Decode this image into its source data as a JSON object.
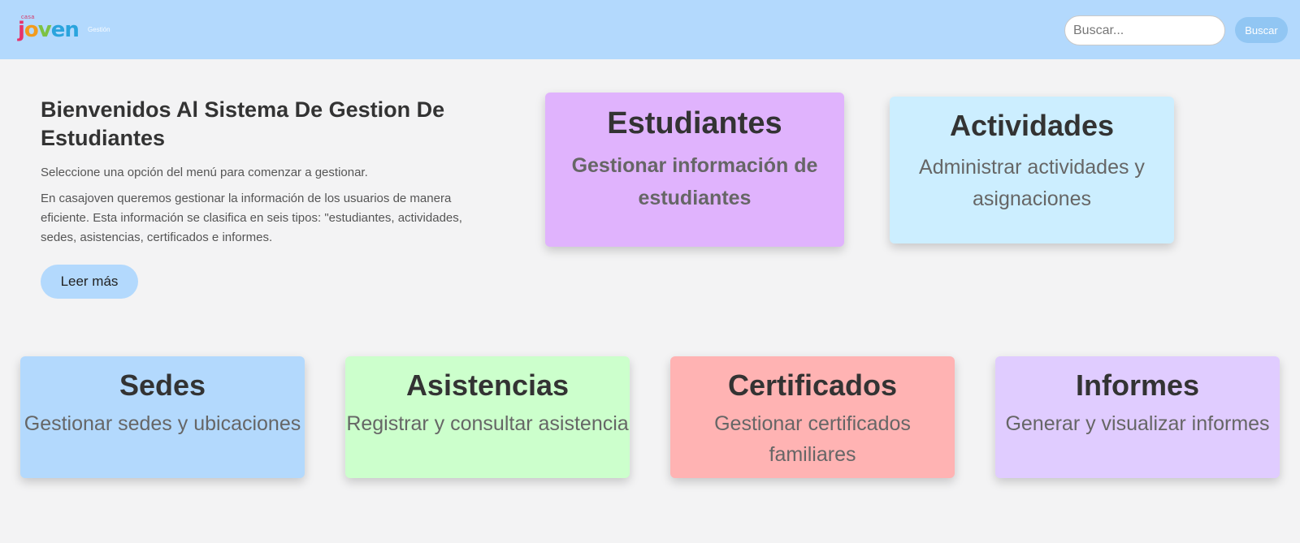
{
  "header": {
    "logo": {
      "small_text": "casa",
      "word": [
        "j",
        "o",
        "v",
        "e",
        "n"
      ],
      "tail": "Gestión"
    },
    "search_placeholder": "Buscar...",
    "search_button_label": "Buscar"
  },
  "welcome": {
    "title": "Bienvenidos Al Sistema De Gestion De Estudiantes",
    "subtitle": "Seleccione una opción del menú para comenzar a gestionar.",
    "description": "En casajoven queremos gestionar la información de los usuarios de manera eficiente. Esta información se clasifica en seis tipos: \"estudiantes, actividades, sedes, asistencias, certificados e informes.",
    "read_more_label": "Leer más"
  },
  "cards": {
    "estudiantes": {
      "title": "Estudiantes",
      "description": "Gestionar información de estudiantes",
      "color": "#e0b3fd"
    },
    "actividades": {
      "title": "Actividades",
      "description": "Administrar actividades y asignaciones",
      "color": "#cceeff"
    },
    "sedes": {
      "title": "Sedes",
      "description": "Gestionar sedes y ubicaciones",
      "color": "#b3d9fd"
    },
    "asistencias": {
      "title": "Asistencias",
      "description": "Registrar y consultar asistencia",
      "color": "#ccffcc"
    },
    "certificados": {
      "title": "Certificados",
      "description": "Gestionar certificados familiares",
      "color": "#ffb3b3"
    },
    "informes": {
      "title": "Informes",
      "description": "Generar y visualizar informes",
      "color": "#e0ccff"
    }
  },
  "colors": {
    "header_background": "#b3d9fd",
    "page_background": "#f3f3f4",
    "search_button": "#91c6f3"
  }
}
